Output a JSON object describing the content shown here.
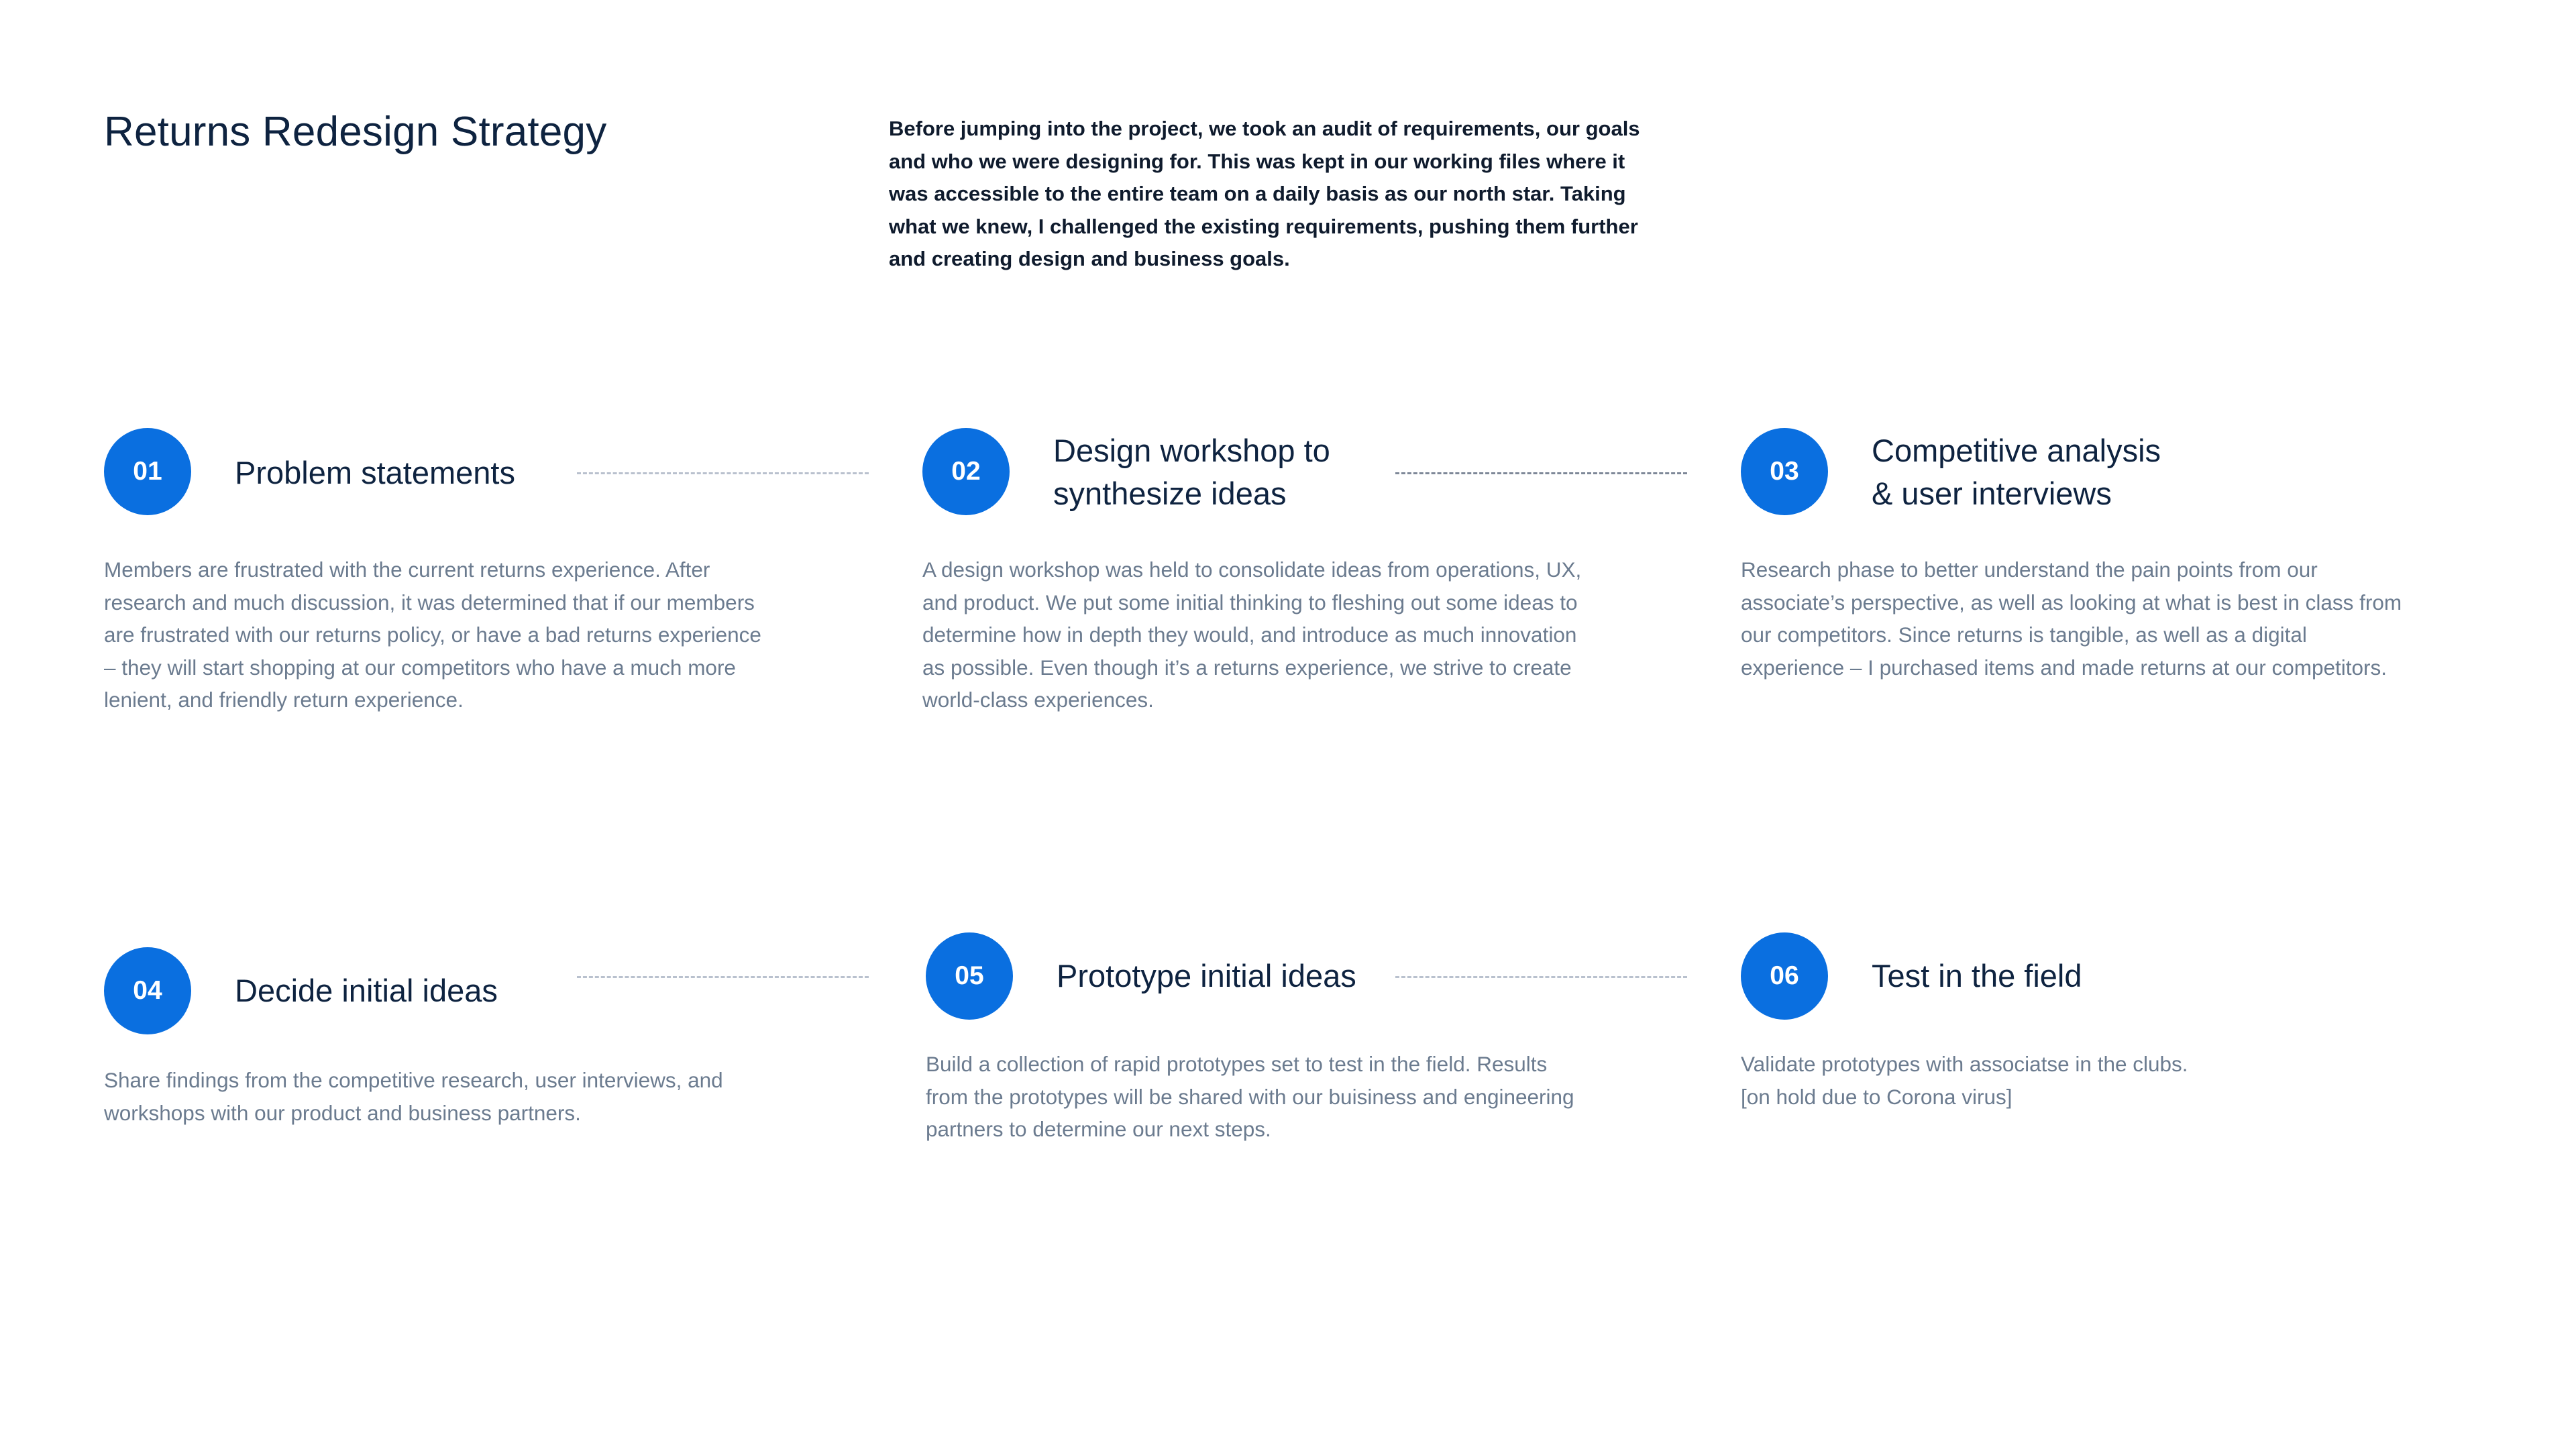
{
  "header": {
    "title": "Returns Redesign Strategy",
    "intro": "Before jumping into the project, we took an audit of requirements, our goals and who we were designing for. This was kept in our working files where it was accessible to the entire team on a daily basis as our north star. Taking what we knew, I challenged the existing requirements, pushing them further and creating design and business goals."
  },
  "colors": {
    "accent": "#0a6fe0",
    "heading": "#0e2340",
    "body_text": "#6b7b8f",
    "connector": "#b9c1ce"
  },
  "steps": [
    {
      "number": "01",
      "title_lines": [
        "Problem statements"
      ],
      "description_lines": [
        "Members are frustrated with the current returns experience. After",
        "research and much discussion, it was determined that if our members",
        "are frustrated with our returns policy, or have a bad returns experience",
        "– they will start shopping at our competitors who have a much more",
        "lenient, and friendly return experience."
      ]
    },
    {
      "number": "02",
      "title_lines": [
        "Design workshop to",
        "synthesize ideas"
      ],
      "description_lines": [
        "A design workshop was held to consolidate ideas from operations, UX,",
        "and product. We put some initial thinking to fleshing out some ideas to",
        "determine how in depth they would, and introduce as much innovation",
        "as possible. Even though it’s a returns experience, we strive to create",
        "world-class experiences."
      ]
    },
    {
      "number": "03",
      "title_lines": [
        "Competitive analysis",
        "& user interviews"
      ],
      "description_lines": [
        "Research phase to better understand the pain points from our",
        "associate’s perspective, as well as looking at what is best in class from",
        "our competitors. Since returns is tangible, as well as a digital",
        "experience – I purchased items and made returns at our competitors."
      ]
    },
    {
      "number": "04",
      "title_lines": [
        "Decide initial ideas"
      ],
      "description_lines": [
        "Share findings from the competitive research, user interviews, and",
        "workshops with our product and business partners."
      ]
    },
    {
      "number": "05",
      "title_lines": [
        "Prototype initial ideas"
      ],
      "description_lines": [
        "Build a collection of rapid prototypes set to test in the field. Results",
        "from the prototypes will be shared with our buisiness and engineering",
        "partners to determine our next steps."
      ]
    },
    {
      "number": "06",
      "title_lines": [
        "Test in the field"
      ],
      "description_lines": [
        "Validate prototypes with associatse in the clubs.",
        "[on hold due to Corona virus]"
      ]
    }
  ]
}
